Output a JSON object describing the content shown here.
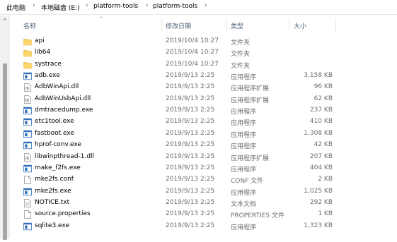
{
  "breadcrumb": {
    "items": [
      "此电脑",
      "本地磁盘 (E:)",
      "platform-tools",
      "platform-tools"
    ]
  },
  "columns": {
    "name": "名称",
    "date": "修改日期",
    "type": "类型",
    "size": "大小"
  },
  "files": [
    {
      "icon": "folder-icon",
      "name": "api",
      "date": "2019/10/4 10:27",
      "type": "文件夹",
      "size": ""
    },
    {
      "icon": "folder-icon",
      "name": "lib64",
      "date": "2019/10/4 10:27",
      "type": "文件夹",
      "size": ""
    },
    {
      "icon": "folder-icon",
      "name": "systrace",
      "date": "2019/10/4 10:27",
      "type": "文件夹",
      "size": ""
    },
    {
      "icon": "exe-icon",
      "name": "adb.exe",
      "date": "2019/9/13 2:25",
      "type": "应用程序",
      "size": "3,158 KB"
    },
    {
      "icon": "dll-icon",
      "name": "AdbWinApi.dll",
      "date": "2019/9/13 2:25",
      "type": "应用程序扩展",
      "size": "96 KB"
    },
    {
      "icon": "dll-icon",
      "name": "AdbWinUsbApi.dll",
      "date": "2019/9/13 2:25",
      "type": "应用程序扩展",
      "size": "62 KB"
    },
    {
      "icon": "exe-icon",
      "name": "dmtracedump.exe",
      "date": "2019/9/13 2:25",
      "type": "应用程序",
      "size": "237 KB"
    },
    {
      "icon": "exe-icon",
      "name": "etc1tool.exe",
      "date": "2019/9/13 2:25",
      "type": "应用程序",
      "size": "410 KB"
    },
    {
      "icon": "exe-icon",
      "name": "fastboot.exe",
      "date": "2019/9/13 2:25",
      "type": "应用程序",
      "size": "1,308 KB"
    },
    {
      "icon": "exe-icon",
      "name": "hprof-conv.exe",
      "date": "2019/9/13 2:25",
      "type": "应用程序",
      "size": "42 KB"
    },
    {
      "icon": "dll-icon",
      "name": "libwinpthread-1.dll",
      "date": "2019/9/13 2:25",
      "type": "应用程序扩展",
      "size": "207 KB"
    },
    {
      "icon": "exe-icon",
      "name": "make_f2fs.exe",
      "date": "2019/9/13 2:25",
      "type": "应用程序",
      "size": "404 KB"
    },
    {
      "icon": "file-icon",
      "name": "mke2fs.conf",
      "date": "2019/9/13 2:25",
      "type": "CONF 文件",
      "size": "2 KB"
    },
    {
      "icon": "exe-icon",
      "name": "mke2fs.exe",
      "date": "2019/9/13 2:25",
      "type": "应用程序",
      "size": "1,025 KB"
    },
    {
      "icon": "text-file-icon",
      "name": "NOTICE.txt",
      "date": "2019/9/13 2:25",
      "type": "文本文档",
      "size": "292 KB"
    },
    {
      "icon": "file-icon",
      "name": "source.properties",
      "date": "2019/9/13 2:25",
      "type": "PROPERTIES 文件",
      "size": "1 KB"
    },
    {
      "icon": "exe-icon",
      "name": "sqlite3.exe",
      "date": "2019/9/13 2:25",
      "type": "应用程序",
      "size": "1,323 KB"
    }
  ],
  "colors": {
    "folder": "#f7c948",
    "exe_blue": "#2f6fb7",
    "header_text": "#4c607a"
  }
}
